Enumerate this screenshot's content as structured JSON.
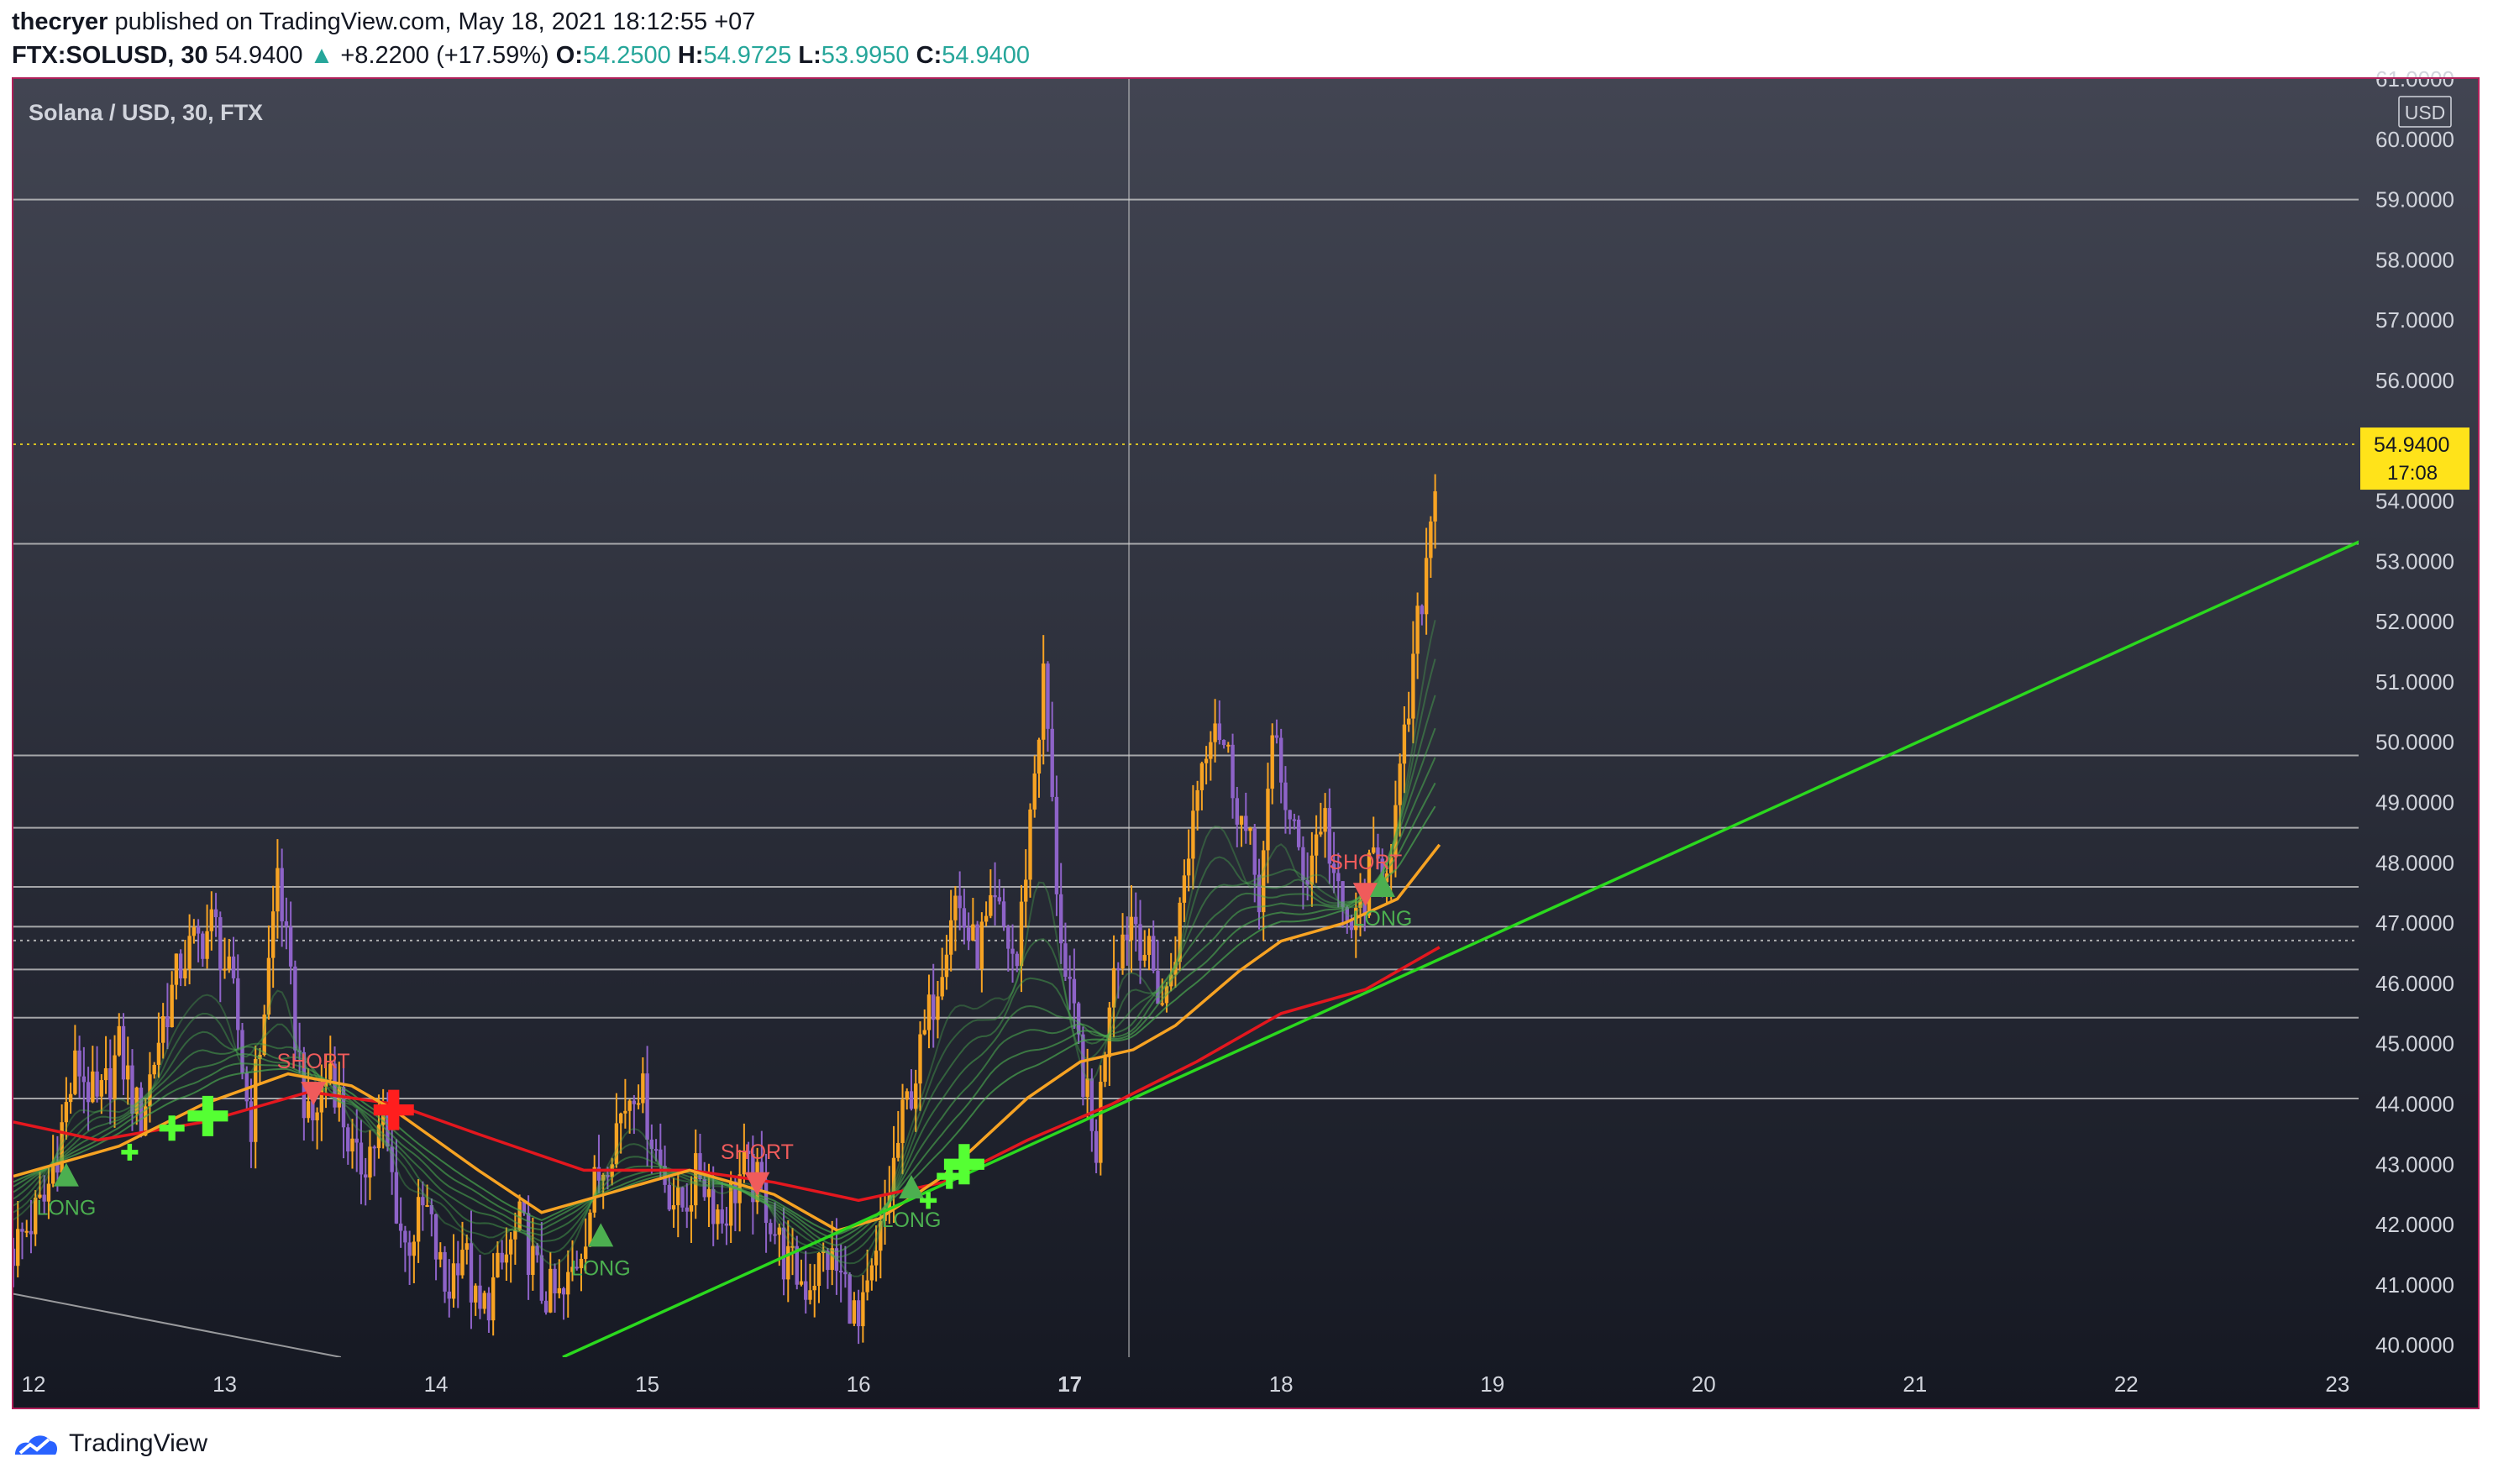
{
  "header": {
    "author": "thecryer",
    "published_text": "published on TradingView.com, May 18, 2021 18:12:55 +07",
    "symbol": "FTX:SOLUSD, 30",
    "last": "54.9400",
    "change": "+8.2200 (+17.59%)",
    "o_label": "O:",
    "o_value": "54.2500",
    "h_label": "H:",
    "h_value": "54.9725",
    "l_label": "L:",
    "l_value": "53.9950",
    "c_label": "C:",
    "c_value": "54.9400"
  },
  "footer": {
    "brand": "TradingView"
  },
  "colors": {
    "panel_top": "#424552",
    "panel_bottom": "#151822",
    "border": "#b0205a",
    "grid": "#d0d0d0",
    "text": "#d1d4dc",
    "bull": "#f7a323",
    "bear": "#8e63c8",
    "ema_fast": "#f7a323",
    "ema_slow": "#e4171e",
    "ribbon": "#4caf50",
    "trend": "#2bd91e",
    "price_label_bg": "#ffe31a",
    "long": "#4caf50",
    "short": "#f05b5b",
    "cross": "#55ff33"
  },
  "chart_data": {
    "type": "candlestick",
    "title": "Solana / USD, 30, FTX",
    "currency": "USD",
    "interval": "30",
    "x_tick_labels": [
      "12",
      "13",
      "14",
      "15",
      "16",
      "17",
      "18",
      "19",
      "20",
      "21",
      "22",
      "23"
    ],
    "y_tick_labels": [
      "40.0000",
      "41.0000",
      "42.0000",
      "43.0000",
      "44.0000",
      "45.0000",
      "46.0000",
      "47.0000",
      "48.0000",
      "49.0000",
      "50.0000",
      "51.0000",
      "52.0000",
      "53.0000",
      "54.0000",
      "55.0000",
      "56.0000",
      "57.0000",
      "58.0000",
      "59.0000",
      "60.0000",
      "61.0000"
    ],
    "ylim": [
      39.8,
      61.0
    ],
    "xlim": [
      12.0,
      23.1
    ],
    "last_price": {
      "value": 54.94,
      "label": "54.9400",
      "countdown": "17:08"
    },
    "horizontal_levels": [
      59.0,
      53.29,
      49.78,
      48.58,
      47.6,
      46.94,
      46.23,
      45.43,
      44.09
    ],
    "dotted_levels": [
      54.94,
      46.71
    ],
    "crosshair_x": 17.28,
    "trendlines": [
      {
        "name": "support",
        "x": [
          14.6,
          23.2
        ],
        "y": [
          39.8,
          53.48
        ]
      },
      {
        "name": "resistance",
        "x": [
          12.0,
          13.55
        ],
        "y": [
          40.85,
          39.8
        ]
      }
    ],
    "closes": [
      {
        "t": 12.0,
        "v": 41.6
      },
      {
        "t": 12.15,
        "v": 42.4
      },
      {
        "t": 12.3,
        "v": 44.7
      },
      {
        "t": 12.4,
        "v": 43.9
      },
      {
        "t": 12.5,
        "v": 44.9
      },
      {
        "t": 12.6,
        "v": 43.7
      },
      {
        "t": 12.7,
        "v": 45.3
      },
      {
        "t": 12.8,
        "v": 46.4
      },
      {
        "t": 12.95,
        "v": 47.0
      },
      {
        "t": 13.05,
        "v": 45.6
      },
      {
        "t": 13.12,
        "v": 43.6
      },
      {
        "t": 13.2,
        "v": 46.0
      },
      {
        "t": 13.25,
        "v": 47.9
      },
      {
        "t": 13.33,
        "v": 45.3
      },
      {
        "t": 13.4,
        "v": 43.5
      },
      {
        "t": 13.5,
        "v": 44.7
      },
      {
        "t": 13.62,
        "v": 42.9
      },
      {
        "t": 13.75,
        "v": 43.6
      },
      {
        "t": 13.85,
        "v": 41.6
      },
      {
        "t": 13.95,
        "v": 42.3
      },
      {
        "t": 14.05,
        "v": 40.8
      },
      {
        "t": 14.12,
        "v": 41.8
      },
      {
        "t": 14.2,
        "v": 40.4
      },
      {
        "t": 14.3,
        "v": 41.2
      },
      {
        "t": 14.4,
        "v": 42.0
      },
      {
        "t": 14.5,
        "v": 40.9
      },
      {
        "t": 14.6,
        "v": 40.7
      },
      {
        "t": 14.68,
        "v": 41.6
      },
      {
        "t": 14.75,
        "v": 42.6
      },
      {
        "t": 14.85,
        "v": 43.6
      },
      {
        "t": 14.95,
        "v": 44.5
      },
      {
        "t": 15.05,
        "v": 43.1
      },
      {
        "t": 15.15,
        "v": 42.2
      },
      {
        "t": 15.25,
        "v": 42.9
      },
      {
        "t": 15.35,
        "v": 42.1
      },
      {
        "t": 15.45,
        "v": 42.9
      },
      {
        "t": 15.55,
        "v": 42.5
      },
      {
        "t": 15.65,
        "v": 41.4
      },
      {
        "t": 15.75,
        "v": 41.0
      },
      {
        "t": 15.85,
        "v": 41.5
      },
      {
        "t": 15.95,
        "v": 40.9
      },
      {
        "t": 16.0,
        "v": 40.2
      },
      {
        "t": 16.08,
        "v": 41.3
      },
      {
        "t": 16.15,
        "v": 42.7
      },
      {
        "t": 16.22,
        "v": 43.9
      },
      {
        "t": 16.3,
        "v": 44.9
      },
      {
        "t": 16.38,
        "v": 46.2
      },
      {
        "t": 16.45,
        "v": 47.5
      },
      {
        "t": 16.55,
        "v": 46.5
      },
      {
        "t": 16.65,
        "v": 47.2
      },
      {
        "t": 16.75,
        "v": 46.3
      },
      {
        "t": 16.82,
        "v": 49.1
      },
      {
        "t": 16.88,
        "v": 51.2
      },
      {
        "t": 16.93,
        "v": 48.0
      },
      {
        "t": 16.98,
        "v": 46.0
      },
      {
        "t": 17.05,
        "v": 44.8
      },
      {
        "t": 17.12,
        "v": 43.1
      },
      {
        "t": 17.2,
        "v": 46.4
      },
      {
        "t": 17.3,
        "v": 47.2
      },
      {
        "t": 17.38,
        "v": 46.3
      },
      {
        "t": 17.45,
        "v": 45.6
      },
      {
        "t": 17.52,
        "v": 47.1
      },
      {
        "t": 17.6,
        "v": 49.3
      },
      {
        "t": 17.68,
        "v": 50.6
      },
      {
        "t": 17.75,
        "v": 49.7
      },
      {
        "t": 17.82,
        "v": 48.6
      },
      {
        "t": 17.9,
        "v": 47.5
      },
      {
        "t": 17.97,
        "v": 50.2
      },
      {
        "t": 18.04,
        "v": 48.6
      },
      {
        "t": 18.12,
        "v": 47.8
      },
      {
        "t": 18.2,
        "v": 48.9
      },
      {
        "t": 18.28,
        "v": 47.1
      },
      {
        "t": 18.35,
        "v": 46.9
      },
      {
        "t": 18.42,
        "v": 47.8
      },
      {
        "t": 18.5,
        "v": 48.1
      },
      {
        "t": 18.55,
        "v": 48.9
      },
      {
        "t": 18.6,
        "v": 50.4
      },
      {
        "t": 18.65,
        "v": 52.0
      },
      {
        "t": 18.7,
        "v": 53.4
      },
      {
        "t": 18.74,
        "v": 54.94
      }
    ],
    "ema_orange": [
      {
        "t": 12.0,
        "v": 42.8
      },
      {
        "t": 12.5,
        "v": 43.3
      },
      {
        "t": 12.9,
        "v": 44.0
      },
      {
        "t": 13.3,
        "v": 44.5
      },
      {
        "t": 13.6,
        "v": 44.3
      },
      {
        "t": 13.8,
        "v": 43.9
      },
      {
        "t": 14.2,
        "v": 42.9
      },
      {
        "t": 14.5,
        "v": 42.2
      },
      {
        "t": 14.9,
        "v": 42.6
      },
      {
        "t": 15.2,
        "v": 42.9
      },
      {
        "t": 15.6,
        "v": 42.5
      },
      {
        "t": 15.9,
        "v": 41.9
      },
      {
        "t": 16.1,
        "v": 42.1
      },
      {
        "t": 16.4,
        "v": 42.8
      },
      {
        "t": 16.8,
        "v": 44.1
      },
      {
        "t": 17.05,
        "v": 44.7
      },
      {
        "t": 17.3,
        "v": 44.9
      },
      {
        "t": 17.5,
        "v": 45.3
      },
      {
        "t": 17.8,
        "v": 46.2
      },
      {
        "t": 18.0,
        "v": 46.7
      },
      {
        "t": 18.3,
        "v": 47.0
      },
      {
        "t": 18.55,
        "v": 47.4
      },
      {
        "t": 18.75,
        "v": 48.3
      }
    ],
    "ema_red": [
      {
        "t": 12.0,
        "v": 43.7
      },
      {
        "t": 12.4,
        "v": 43.4
      },
      {
        "t": 12.9,
        "v": 43.7
      },
      {
        "t": 13.4,
        "v": 44.2
      },
      {
        "t": 13.8,
        "v": 44.0
      },
      {
        "t": 14.2,
        "v": 43.5
      },
      {
        "t": 14.7,
        "v": 42.9
      },
      {
        "t": 15.2,
        "v": 42.9
      },
      {
        "t": 15.6,
        "v": 42.7
      },
      {
        "t": 16.0,
        "v": 42.4
      },
      {
        "t": 16.4,
        "v": 42.7
      },
      {
        "t": 16.8,
        "v": 43.4
      },
      {
        "t": 17.2,
        "v": 44.0
      },
      {
        "t": 17.6,
        "v": 44.7
      },
      {
        "t": 18.0,
        "v": 45.5
      },
      {
        "t": 18.4,
        "v": 45.9
      },
      {
        "t": 18.75,
        "v": 46.6
      }
    ],
    "signals": [
      {
        "type": "long",
        "label": "LONG",
        "t": 12.25,
        "v": 42.8
      },
      {
        "type": "short",
        "label": "SHORT",
        "t": 13.42,
        "v": 44.2
      },
      {
        "type": "long",
        "label": "LONG",
        "t": 14.78,
        "v": 41.8
      },
      {
        "type": "short",
        "label": "SHORT",
        "t": 15.52,
        "v": 42.7
      },
      {
        "type": "long",
        "label": "LONG",
        "t": 16.25,
        "v": 42.6
      },
      {
        "type": "short",
        "label": "SHORT",
        "t": 18.4,
        "v": 47.5
      },
      {
        "type": "long",
        "label": "LONG",
        "t": 18.48,
        "v": 47.6
      }
    ],
    "crosses": [
      {
        "color": "green",
        "t": 12.55,
        "v": 43.2,
        "size": "small"
      },
      {
        "color": "green",
        "t": 12.75,
        "v": 43.6,
        "size": "medium"
      },
      {
        "color": "green",
        "t": 12.92,
        "v": 43.8,
        "size": "large"
      },
      {
        "color": "red",
        "t": 13.8,
        "v": 43.9,
        "size": "large"
      },
      {
        "color": "green",
        "t": 16.33,
        "v": 42.4,
        "size": "small"
      },
      {
        "color": "green",
        "t": 16.43,
        "v": 42.8,
        "size": "medium"
      },
      {
        "color": "green",
        "t": 16.5,
        "v": 43.0,
        "size": "large"
      }
    ]
  }
}
